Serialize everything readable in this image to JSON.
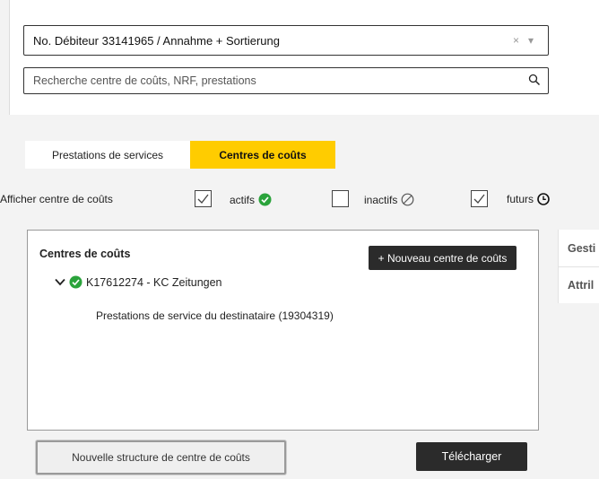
{
  "debtor_select": {
    "value": "No. Débiteur 33141965 / Annahme + Sortierung",
    "clear_glyph": "×",
    "arrow_glyph": "▾"
  },
  "search": {
    "placeholder": "Recherche centre de coûts, NRF, prestations",
    "icon": "search-icon"
  },
  "tabs": [
    {
      "label": "Prestations de services",
      "active": false
    },
    {
      "label": "Centres de coûts",
      "active": true
    }
  ],
  "filters": {
    "label": "Afficher centre de coûts",
    "items": [
      {
        "label": "actifs",
        "checked": true,
        "icon": "check-circle-icon"
      },
      {
        "label": "inactifs",
        "checked": false,
        "icon": "disabled-circle-icon"
      },
      {
        "label": "futurs",
        "checked": true,
        "icon": "clock-icon"
      }
    ]
  },
  "tree": {
    "title": "Centres de coûts",
    "new_button": "+ Nouveau centre de coûts",
    "node_label": "K17612274 - KC Zeitungen",
    "child_label": "Prestations de service du destinataire (19304319)"
  },
  "side_panel": {
    "items": [
      "Gesti",
      "Attril"
    ]
  },
  "actions": {
    "new_structure": "Nouvelle structure de centre de coûts",
    "download": "Télécharger"
  },
  "colors": {
    "accent": "#ffcc00",
    "dark_button": "#2b2b2b",
    "active_green": "#2aa33b"
  }
}
